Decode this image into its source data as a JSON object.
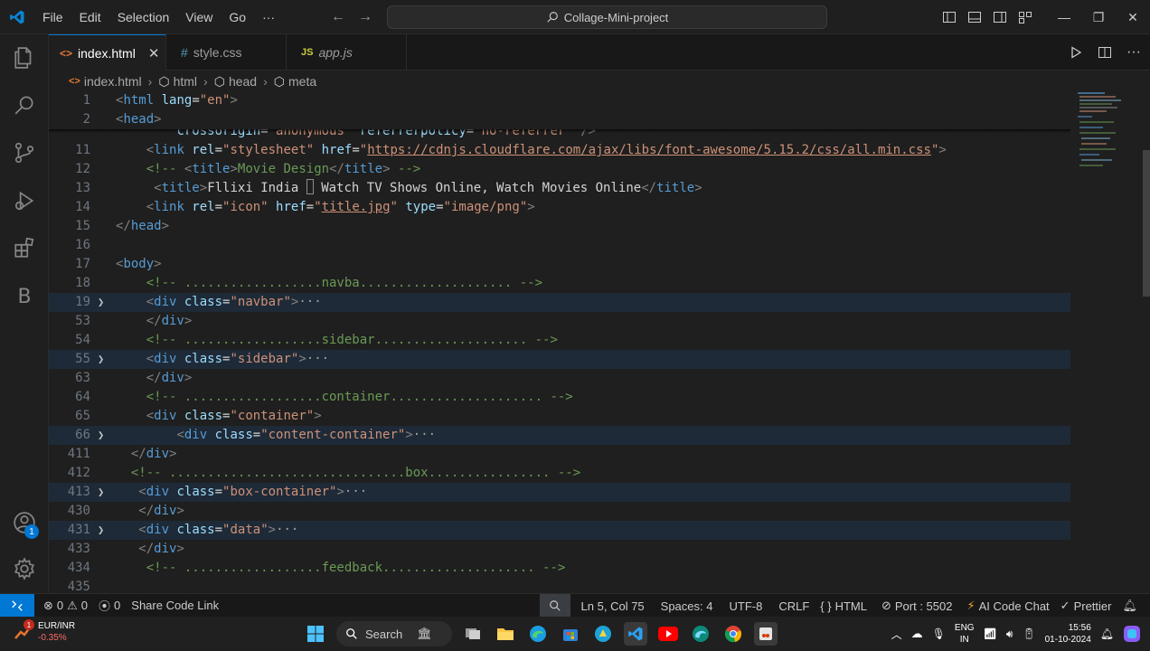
{
  "titlebar": {
    "menu": [
      "File",
      "Edit",
      "Selection",
      "View",
      "Go",
      "···"
    ],
    "search_text": "Collage-Mini-project"
  },
  "tabs": [
    {
      "icon": "<>",
      "label": "index.html",
      "close": "✕"
    },
    {
      "icon": "#",
      "label": "style.css"
    },
    {
      "icon": "JS",
      "label": "app.js"
    }
  ],
  "breadcrumb": [
    "index.html",
    "html",
    "head",
    "meta"
  ],
  "editor": {
    "lines": [
      {
        "num": "1",
        "segments": [
          [
            "brk",
            "<"
          ],
          [
            "tag",
            "html"
          ],
          [
            "attr",
            " lang"
          ],
          [
            "txt",
            "="
          ],
          [
            "str",
            "\"en\""
          ],
          [
            "brk",
            ">"
          ]
        ]
      },
      {
        "num": "2",
        "segments": [
          [
            "brk",
            "<"
          ],
          [
            "tag",
            "head"
          ],
          [
            "brk",
            ">"
          ]
        ]
      },
      {
        "num": "",
        "segments": [
          [
            "txt",
            "        "
          ],
          [
            "attr",
            "crossorigin"
          ],
          [
            "txt",
            "="
          ],
          [
            "str",
            "\"anonymous\""
          ],
          [
            "attr",
            " referrerpolicy"
          ],
          [
            "txt",
            "="
          ],
          [
            "str",
            "\"no-referrer\""
          ],
          [
            "brk",
            " />"
          ]
        ]
      },
      {
        "num": "11",
        "segments": [
          [
            "txt",
            "    "
          ],
          [
            "brk",
            "<"
          ],
          [
            "tag",
            "link"
          ],
          [
            "attr",
            " rel"
          ],
          [
            "txt",
            "="
          ],
          [
            "str",
            "\"stylesheet\""
          ],
          [
            "attr",
            " href"
          ],
          [
            "txt",
            "="
          ],
          [
            "str",
            "\""
          ],
          [
            "lnk",
            "https://cdnjs.cloudflare.com/ajax/libs/font-awesome/5.15.2/css/all.min.css"
          ],
          [
            "str",
            "\""
          ],
          [
            "brk",
            ">"
          ]
        ]
      },
      {
        "num": "12",
        "segments": [
          [
            "txt",
            "    "
          ],
          [
            "cmt",
            "<!-- "
          ],
          [
            "brk",
            "<"
          ],
          [
            "tag",
            "title"
          ],
          [
            "brk",
            ">"
          ],
          [
            "cmt",
            "Movie Design"
          ],
          [
            "brk",
            "</"
          ],
          [
            "tag",
            "title"
          ],
          [
            "brk",
            ">"
          ],
          [
            "cmt",
            " -->"
          ]
        ]
      },
      {
        "num": "13",
        "segments": [
          [
            "txt",
            "     "
          ],
          [
            "brk",
            "<"
          ],
          [
            "tag",
            "title"
          ],
          [
            "brk",
            ">"
          ],
          [
            "txt",
            "Fllixi India "
          ],
          [
            "cursor",
            ""
          ],
          [
            "txt",
            " Watch TV Shows Online, Watch Movies Online"
          ],
          [
            "brk",
            "</"
          ],
          [
            "tag",
            "title"
          ],
          [
            "brk",
            ">"
          ]
        ]
      },
      {
        "num": "14",
        "segments": [
          [
            "txt",
            "    "
          ],
          [
            "brk",
            "<"
          ],
          [
            "tag",
            "link"
          ],
          [
            "attr",
            " rel"
          ],
          [
            "txt",
            "="
          ],
          [
            "str",
            "\"icon\""
          ],
          [
            "attr",
            " href"
          ],
          [
            "txt",
            "="
          ],
          [
            "str",
            "\""
          ],
          [
            "lnk",
            "title.jpg"
          ],
          [
            "str",
            "\""
          ],
          [
            "attr",
            " type"
          ],
          [
            "txt",
            "="
          ],
          [
            "str",
            "\"image/png\""
          ],
          [
            "brk",
            ">"
          ]
        ]
      },
      {
        "num": "15",
        "segments": [
          [
            "brk",
            "</"
          ],
          [
            "tag",
            "head"
          ],
          [
            "brk",
            ">"
          ]
        ]
      },
      {
        "num": "16",
        "segments": []
      },
      {
        "num": "17",
        "segments": [
          [
            "brk",
            "<"
          ],
          [
            "tag",
            "body"
          ],
          [
            "brk",
            ">"
          ]
        ]
      },
      {
        "num": "18",
        "segments": [
          [
            "txt",
            "    "
          ],
          [
            "cmt",
            "<!-- ..................navba.................... -->"
          ]
        ]
      },
      {
        "num": "19",
        "fold": true,
        "hl": true,
        "segments": [
          [
            "txt",
            "    "
          ],
          [
            "brk",
            "<"
          ],
          [
            "tag",
            "div"
          ],
          [
            "attr",
            " class"
          ],
          [
            "txt",
            "="
          ],
          [
            "str",
            "\"navbar\""
          ],
          [
            "brk",
            ">"
          ],
          [
            "dots",
            "···"
          ]
        ]
      },
      {
        "num": "53",
        "segments": [
          [
            "txt",
            "    "
          ],
          [
            "brk",
            "</"
          ],
          [
            "tag",
            "div"
          ],
          [
            "brk",
            ">"
          ]
        ]
      },
      {
        "num": "54",
        "segments": [
          [
            "txt",
            "    "
          ],
          [
            "cmt",
            "<!-- ..................sidebar.................... -->"
          ]
        ]
      },
      {
        "num": "55",
        "fold": true,
        "hl": true,
        "segments": [
          [
            "txt",
            "    "
          ],
          [
            "brk",
            "<"
          ],
          [
            "tag",
            "div"
          ],
          [
            "attr",
            " class"
          ],
          [
            "txt",
            "="
          ],
          [
            "str",
            "\"sidebar\""
          ],
          [
            "brk",
            ">"
          ],
          [
            "dots",
            "···"
          ]
        ]
      },
      {
        "num": "63",
        "segments": [
          [
            "txt",
            "    "
          ],
          [
            "brk",
            "</"
          ],
          [
            "tag",
            "div"
          ],
          [
            "brk",
            ">"
          ]
        ]
      },
      {
        "num": "64",
        "segments": [
          [
            "txt",
            "    "
          ],
          [
            "cmt",
            "<!-- ..................container.................... -->"
          ]
        ]
      },
      {
        "num": "65",
        "segments": [
          [
            "txt",
            "    "
          ],
          [
            "brk",
            "<"
          ],
          [
            "tag",
            "div"
          ],
          [
            "attr",
            " class"
          ],
          [
            "txt",
            "="
          ],
          [
            "str",
            "\"container\""
          ],
          [
            "brk",
            ">"
          ]
        ]
      },
      {
        "num": "66",
        "fold": true,
        "hl": true,
        "segments": [
          [
            "txt",
            "        "
          ],
          [
            "brk",
            "<"
          ],
          [
            "tag",
            "div"
          ],
          [
            "attr",
            " class"
          ],
          [
            "txt",
            "="
          ],
          [
            "str",
            "\"content-container\""
          ],
          [
            "brk",
            ">"
          ],
          [
            "dots",
            "···"
          ]
        ]
      },
      {
        "num": "411",
        "segments": [
          [
            "txt",
            "  "
          ],
          [
            "brk",
            "</"
          ],
          [
            "tag",
            "div"
          ],
          [
            "brk",
            ">"
          ]
        ]
      },
      {
        "num": "412",
        "segments": [
          [
            "txt",
            "  "
          ],
          [
            "cmt",
            "<!-- ...............................box................ -->"
          ]
        ]
      },
      {
        "num": "413",
        "fold": true,
        "hl": true,
        "segments": [
          [
            "txt",
            "   "
          ],
          [
            "brk",
            "<"
          ],
          [
            "tag",
            "div"
          ],
          [
            "attr",
            " class"
          ],
          [
            "txt",
            "="
          ],
          [
            "str",
            "\"box-container\""
          ],
          [
            "brk",
            ">"
          ],
          [
            "dots",
            "···"
          ]
        ]
      },
      {
        "num": "430",
        "segments": [
          [
            "txt",
            "   "
          ],
          [
            "brk",
            "</"
          ],
          [
            "tag",
            "div"
          ],
          [
            "brk",
            ">"
          ]
        ]
      },
      {
        "num": "431",
        "fold": true,
        "hl": true,
        "segments": [
          [
            "txt",
            "   "
          ],
          [
            "brk",
            "<"
          ],
          [
            "tag",
            "div"
          ],
          [
            "attr",
            " class"
          ],
          [
            "txt",
            "="
          ],
          [
            "str",
            "\"data\""
          ],
          [
            "brk",
            ">"
          ],
          [
            "dots",
            "···"
          ]
        ]
      },
      {
        "num": "433",
        "segments": [
          [
            "txt",
            "   "
          ],
          [
            "brk",
            "</"
          ],
          [
            "tag",
            "div"
          ],
          [
            "brk",
            ">"
          ]
        ]
      },
      {
        "num": "434",
        "segments": [
          [
            "txt",
            "    "
          ],
          [
            "cmt",
            "<!-- ..................feedback.................... -->"
          ]
        ]
      },
      {
        "num": "435",
        "segments": []
      }
    ]
  },
  "activity": {
    "accounts_badge": "1"
  },
  "statusbar": {
    "errors": "0",
    "warnings": "0",
    "ports": "0",
    "share": "Share Code Link",
    "position": "Ln 5, Col 75",
    "spaces": "Spaces: 4",
    "encoding": "UTF-8",
    "eol": "CRLF",
    "language": "HTML",
    "port": "Port : 5502",
    "ai": "AI Code Chat",
    "prettier": "Prettier"
  },
  "taskbar": {
    "ticker_badge": "1",
    "ticker_name": "EUR/INR",
    "ticker_change": "-0.35%",
    "search": "Search",
    "lang_top": "ENG",
    "lang_bottom": "IN",
    "time": "15:56",
    "date": "01-10-2024"
  },
  "colors": {
    "accent": "#0078d4",
    "ticker_down": "#ff6b6b"
  }
}
